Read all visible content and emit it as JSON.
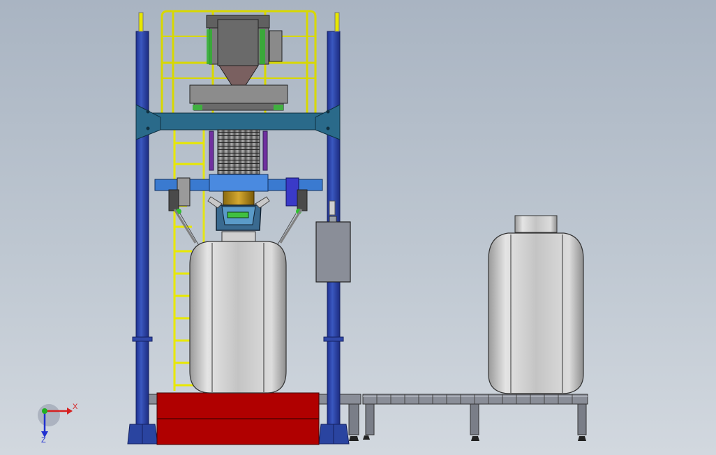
{
  "viewport": {
    "triad": {
      "x_label": "X",
      "z_label": "Z",
      "y_label": "",
      "x_color": "#d62020",
      "z_color": "#2030d0",
      "y_color": "#20b020"
    }
  },
  "palette": {
    "background_top": "#a9b4c2",
    "background_bottom": "#d2d8df",
    "frame_blue": "#3048a8",
    "beam_teal": "#2a6a8a",
    "ladder_yellow": "#e8e800",
    "pallet_red": "#b00000",
    "bag_grey": "#c8c8c8",
    "conveyor_grey": "#8a8e98"
  },
  "model": {
    "components": [
      "left-column",
      "right-column",
      "top-crossbeam",
      "safety-railing",
      "access-ladder",
      "hopper-feeder",
      "bellows",
      "bag-clamp-beam",
      "spout-assembly",
      "bulk-bag-filling",
      "bulk-bag-filled",
      "control-box",
      "pallet-platform",
      "roller-conveyor"
    ]
  }
}
